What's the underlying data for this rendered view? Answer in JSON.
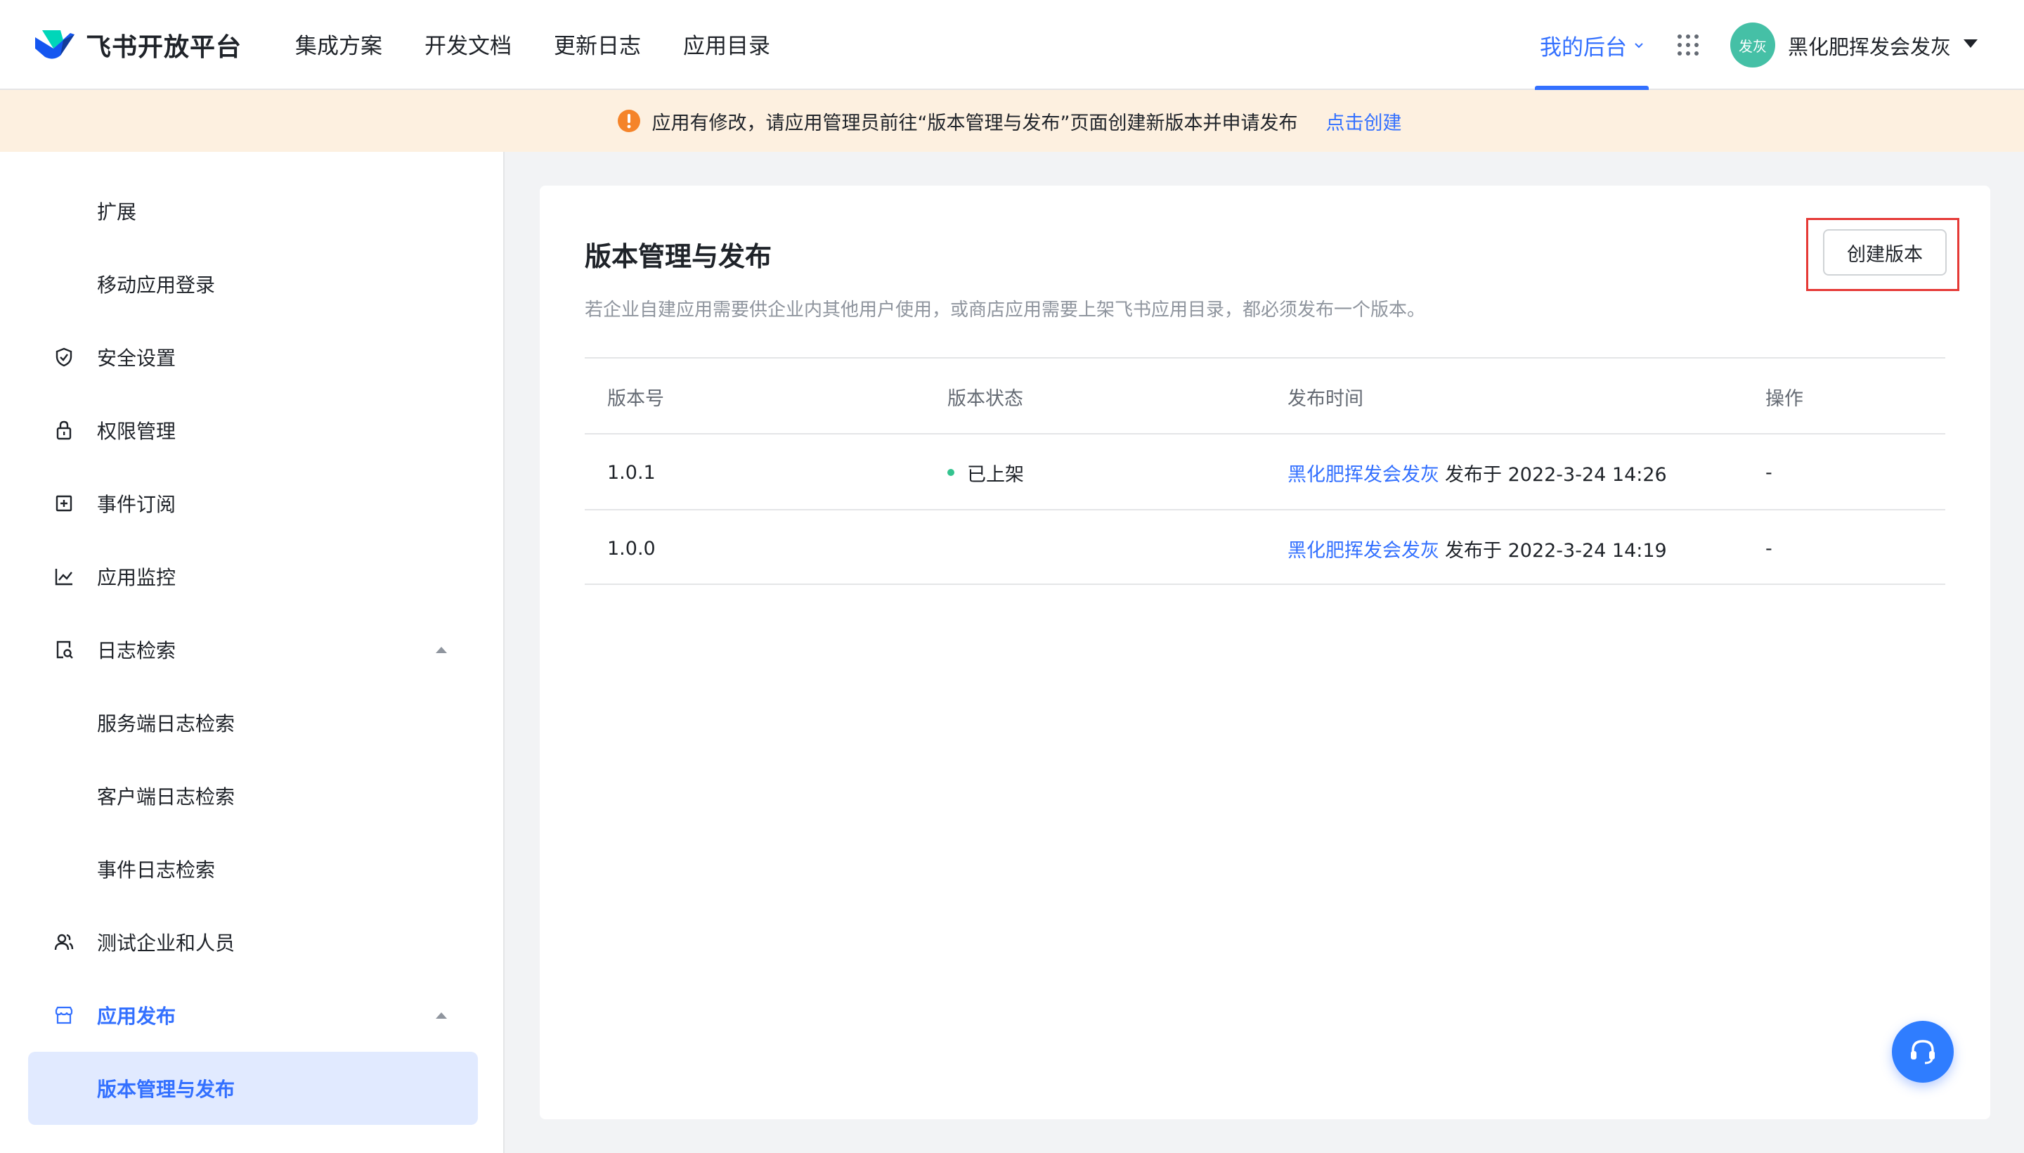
{
  "header": {
    "brand": "飞书开放平台",
    "nav": [
      "集成方案",
      "开发文档",
      "更新日志",
      "应用目录"
    ],
    "my_console": "我的后台",
    "avatar_text": "发灰",
    "user_name": "黑化肥挥发会发灰"
  },
  "banner": {
    "text": "应用有修改，请应用管理员前往“版本管理与发布”页面创建新版本并申请发布",
    "link": "点击创建"
  },
  "sidebar": {
    "items": [
      {
        "label": "扩展",
        "icon": ""
      },
      {
        "label": "移动应用登录",
        "icon": ""
      },
      {
        "label": "安全设置",
        "icon": "shield-icon"
      },
      {
        "label": "权限管理",
        "icon": "lock-icon"
      },
      {
        "label": "事件订阅",
        "icon": "plus-square-icon"
      },
      {
        "label": "应用监控",
        "icon": "line-chart-icon"
      },
      {
        "label": "日志检索",
        "icon": "log-search-icon"
      },
      {
        "label": "服务端日志检索",
        "icon": ""
      },
      {
        "label": "客户端日志检索",
        "icon": ""
      },
      {
        "label": "事件日志检索",
        "icon": ""
      },
      {
        "label": "测试企业和人员",
        "icon": "users-icon"
      },
      {
        "label": "应用发布",
        "icon": "store-icon"
      },
      {
        "label": "版本管理与发布",
        "icon": ""
      }
    ]
  },
  "main": {
    "title": "版本管理与发布",
    "description": "若企业自建应用需要供企业内其他用户使用，或商店应用需要上架飞书应用目录，都必须发布一个版本。",
    "create_button": "创建版本",
    "table": {
      "headers": [
        "版本号",
        "版本状态",
        "发布时间",
        "操作"
      ],
      "rows": [
        {
          "version": "1.0.1",
          "status": "已上架",
          "publisher": "黑化肥挥发会发灰",
          "time": "发布于 2022-3-24 14:26",
          "action": "-"
        },
        {
          "version": "1.0.0",
          "status": "",
          "publisher": "黑化肥挥发会发灰",
          "time": "发布于 2022-3-24 14:19",
          "action": "-"
        }
      ]
    }
  },
  "colors": {
    "accent": "#3370ff",
    "banner_bg": "#fdf0e0",
    "warning": "#f5842a",
    "status_green": "#34c38f",
    "highlight_frame": "#e53935"
  }
}
